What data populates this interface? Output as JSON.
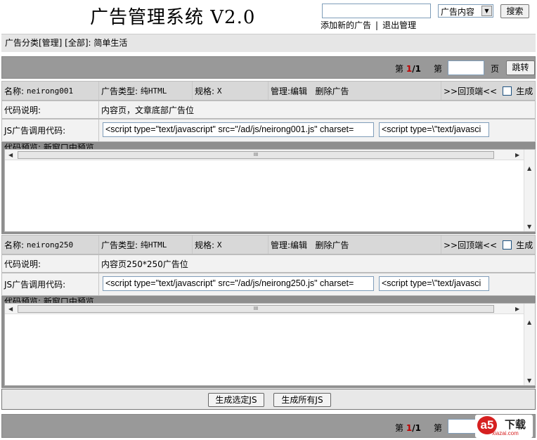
{
  "header": {
    "title": "广告管理系统 V2.0",
    "search_placeholder": "",
    "search_scope": "广告内容",
    "search_button": "搜索",
    "links": [
      "添加新的广告",
      "退出管理"
    ],
    "link_separator": "|"
  },
  "breadcrumb": "广告分类[管理] [全部]: 简单生活",
  "pager": {
    "prefix": "第",
    "current": "1",
    "slash": "/",
    "total": "1",
    "goto_prefix": "第",
    "goto_suffix": "页",
    "jump_button": "跳转"
  },
  "ads": [
    {
      "name_label": "名称:",
      "name": "neirong001",
      "type_label": "广告类型:",
      "type": "纯HTML",
      "spec_label": "规格:",
      "spec": "X",
      "manage_label": "管理:",
      "edit": "编辑",
      "delete": "删除广告",
      "back_top": ">>回顶端<<",
      "generate": "生成",
      "desc_label": "代码说明:",
      "desc": "内容页，文章底部广告位",
      "js_label": "JS广告调用代码:",
      "js_code": "<script type=\"text/javascript\" src=\"/ad/js/neirong001.js\"  charset=",
      "js_escaped": "<script type=\\\"text/javasci",
      "preview_label": "代码预览:  新窗口中预览"
    },
    {
      "name_label": "名称:",
      "name": "neirong250",
      "type_label": "广告类型:",
      "type": "纯HTML",
      "spec_label": "规格:",
      "spec": "X",
      "manage_label": "管理:",
      "edit": "编辑",
      "delete": "删除广告",
      "back_top": ">>回顶端<<",
      "generate": "生成",
      "desc_label": "代码说明:",
      "desc": "内容页250*250广告位",
      "js_label": "JS广告调用代码:",
      "js_code": "<script type=\"text/javascript\" src=\"/ad/js/neirong250.js\"  charset=",
      "js_escaped": "<script type=\\\"text/javasci",
      "preview_label": "代码预览:  新窗口中预览"
    }
  ],
  "actions": {
    "generate_selected": "生成选定JS",
    "generate_all": "生成所有JS"
  },
  "scroll_thumb_glyph": "III",
  "watermark": {
    "brand": "a5",
    "cn": "下载",
    "en": "xiazai.com"
  }
}
